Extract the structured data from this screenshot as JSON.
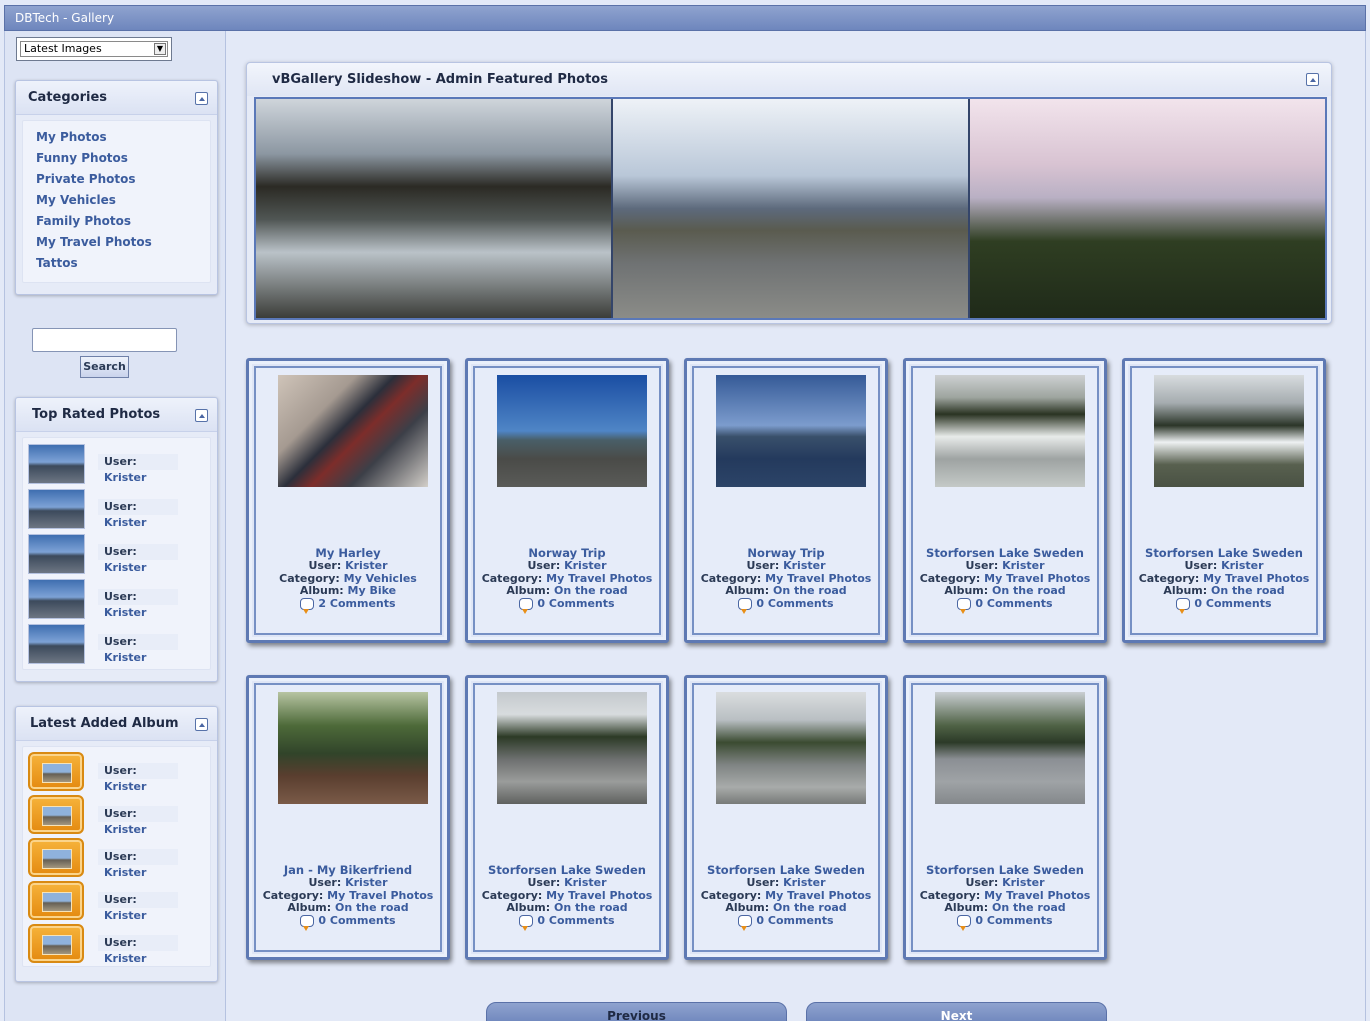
{
  "window": {
    "title": "DBTech - Gallery"
  },
  "sidebar": {
    "view_select": {
      "selected": "Latest Images"
    },
    "categories": {
      "title": "Categories",
      "items": [
        "My Photos",
        "Funny Photos",
        "Private Photos",
        "My Vehicles",
        "Family Photos",
        "My Travel Photos",
        "Tattos"
      ]
    },
    "search": {
      "button_label": "Search",
      "value": ""
    },
    "top_rated": {
      "title": "Top Rated Photos",
      "items": [
        {
          "user_label": "User:",
          "user": "Krister"
        },
        {
          "user_label": "User:",
          "user": "Krister"
        },
        {
          "user_label": "User:",
          "user": "Krister"
        },
        {
          "user_label": "User:",
          "user": "Krister"
        },
        {
          "user_label": "User:",
          "user": "Krister"
        }
      ]
    },
    "latest_album": {
      "title": "Latest Added Album",
      "items": [
        {
          "user_label": "User:",
          "user": "Krister"
        },
        {
          "user_label": "User:",
          "user": "Krister"
        },
        {
          "user_label": "User:",
          "user": "Krister"
        },
        {
          "user_label": "User:",
          "user": "Krister"
        },
        {
          "user_label": "User:",
          "user": "Krister"
        }
      ]
    }
  },
  "slideshow": {
    "title": "vBGallery Slideshow - Admin Featured Photos"
  },
  "labels": {
    "user": "User:",
    "category": "Category:",
    "album": "Album:"
  },
  "cards": [
    {
      "title": "My Harley",
      "user": "Krister",
      "category": "My Vehicles",
      "album": "My Bike",
      "comments": "2 Comments"
    },
    {
      "title": "Norway Trip",
      "user": "Krister",
      "category": "My Travel Photos",
      "album": "On the road",
      "comments": "0 Comments"
    },
    {
      "title": "Norway Trip",
      "user": "Krister",
      "category": "My Travel Photos",
      "album": "On the road",
      "comments": "0 Comments"
    },
    {
      "title": "Storforsen Lake Sweden",
      "user": "Krister",
      "category": "My Travel Photos",
      "album": "On the road",
      "comments": "0 Comments"
    },
    {
      "title": "Storforsen Lake Sweden",
      "user": "Krister",
      "category": "My Travel Photos",
      "album": "On the road",
      "comments": "0 Comments"
    },
    {
      "title": "Jan - My Bikerfriend",
      "user": "Krister",
      "category": "My Travel Photos",
      "album": "On the road",
      "comments": "0 Comments"
    },
    {
      "title": "Storforsen Lake Sweden",
      "user": "Krister",
      "category": "My Travel Photos",
      "album": "On the road",
      "comments": "0 Comments"
    },
    {
      "title": "Storforsen Lake Sweden",
      "user": "Krister",
      "category": "My Travel Photos",
      "album": "On the road",
      "comments": "0 Comments"
    },
    {
      "title": "Storforsen Lake Sweden",
      "user": "Krister",
      "category": "My Travel Photos",
      "album": "On the road",
      "comments": "0 Comments"
    }
  ],
  "pager": {
    "previous": "Previous",
    "next": "Next"
  },
  "colors": {
    "accent": "#3b5c9e",
    "frame": "#5e79b3",
    "titlebar": "#7b90c4"
  }
}
